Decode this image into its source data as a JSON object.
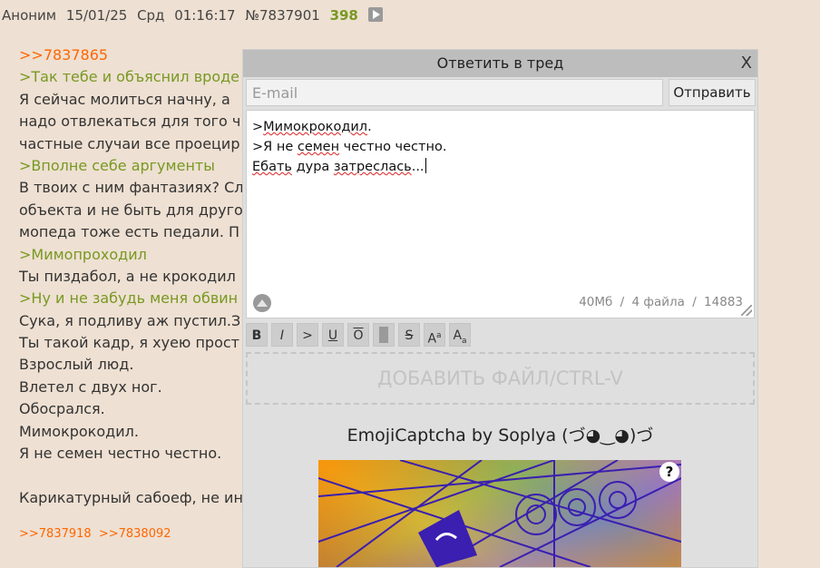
{
  "post": {
    "name": "Аноним",
    "date": "15/01/25",
    "weekday": "Срд",
    "time": "01:16:17",
    "num": "№7837901",
    "count": "398",
    "lines": [
      {
        "type": "reply-link",
        "text": ">>7837865"
      },
      {
        "type": "quote",
        "text": ">Так тебе и объяснил вроде"
      },
      {
        "type": "text",
        "text": "Я сейчас молиться начну, а"
      },
      {
        "type": "text",
        "text": "надо отвлекаться для того ч"
      },
      {
        "type": "text",
        "text": "частные случаи все проецир"
      },
      {
        "type": "quote",
        "text": ">Вполне себе аргументы"
      },
      {
        "type": "text",
        "text": "В твоих с ним фантазиях? Сл"
      },
      {
        "type": "text",
        "text": "объекта и не быть для друго"
      },
      {
        "type": "text",
        "text": "мопеда тоже есть педали. П"
      },
      {
        "type": "quote",
        "text": ">Мимопроходил"
      },
      {
        "type": "text",
        "text": "Ты пиздабол, а не крокодил"
      },
      {
        "type": "quote",
        "text": ">Ну и не забудь меня обвин"
      },
      {
        "type": "text",
        "text": "Сука, я подливу аж пустил.З"
      },
      {
        "type": "text",
        "text": "Ты такой кадр, я хуею прост"
      },
      {
        "type": "text",
        "text": "Взрослый люд."
      },
      {
        "type": "text",
        "text": "Влетел с двух ног."
      },
      {
        "type": "text",
        "text": "Обосрался."
      },
      {
        "type": "text",
        "text": "Мимокрокодил."
      },
      {
        "type": "text",
        "text": "Я не семен честно честно."
      },
      {
        "type": "blank",
        "text": ""
      },
      {
        "type": "text",
        "text": "Карикатурный сабоеф, не ин"
      }
    ],
    "replies": [
      ">>7837918",
      ">>7838092"
    ]
  },
  "form": {
    "title": "Ответить в тред",
    "close": "X",
    "email_placeholder": "E-mail",
    "submit": "Отправить",
    "message_lines": [
      ">Мимокрокодил.",
      ">Я не семен честно честно.",
      "Ебать дура затреслась..."
    ],
    "limits": {
      "size": "40Мб",
      "sep": "/",
      "files": "4 файла",
      "chars": "14883"
    },
    "toolbar": [
      "B",
      "I",
      ">",
      "U",
      "O",
      "",
      "S",
      "A",
      "A"
    ],
    "add_file": "ДОБАВИТЬ ФАЙЛ/CTRL-V",
    "captcha_title": "EmojiCaptcha by Soplya (づ◕‿◕)づ",
    "captcha_help": "?"
  },
  "colors": {
    "background": "#eee0d2",
    "reply_link": "#ff6600",
    "quote": "#789922",
    "form_bg": "#dfdfdf",
    "form_header": "#bdbdbd"
  }
}
